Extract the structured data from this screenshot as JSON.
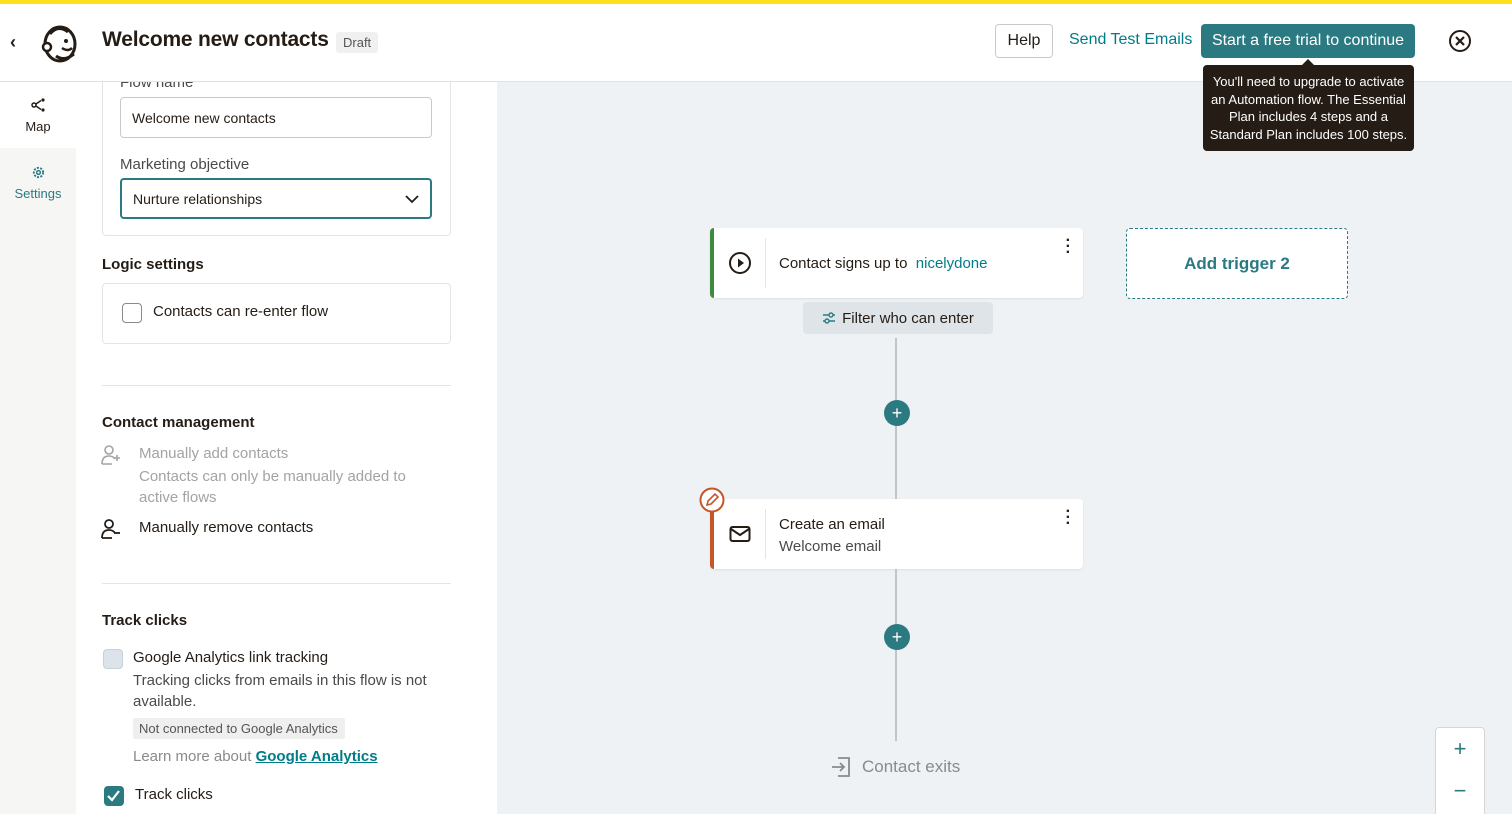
{
  "header": {
    "title": "Welcome new contacts",
    "badge": "Draft",
    "help_label": "Help",
    "send_test_label": "Send Test Emails",
    "trial_label": "Start a free trial to continue"
  },
  "tooltip": {
    "text": "You'll need to upgrade to activate an Automation flow. The Essential Plan includes 4 steps and a Standard Plan includes 100 steps."
  },
  "rail": {
    "map_label": "Map",
    "settings_label": "Settings"
  },
  "panel": {
    "flow_name_label": "Flow name",
    "flow_name_value": "Welcome new contacts",
    "objective_label": "Marketing objective",
    "objective_value": "Nurture relationships",
    "logic_heading": "Logic settings",
    "reenter_label": "Contacts can re-enter flow",
    "contact_mgmt_heading": "Contact management",
    "manual_add_title": "Manually add contacts",
    "manual_add_desc": "Contacts can only be manually added to active flows",
    "manual_remove_title": "Manually remove contacts",
    "track_heading": "Track clicks",
    "ga_title": "Google Analytics link tracking",
    "ga_desc": "Tracking clicks from emails in this flow is not available.",
    "ga_pill": "Not connected to Google Analytics",
    "learn_prefix": "Learn more about",
    "learn_link": "Google Analytics",
    "track_clicks_label": "Track clicks"
  },
  "canvas": {
    "trigger_text": "Contact signs up to",
    "trigger_audience": "nicelydone",
    "filter_label": "Filter who can enter",
    "add_trigger_label": "Add trigger 2",
    "email_title": "Create an email",
    "email_subtitle": "Welcome email",
    "exit_label": "Contact exits",
    "plus_symbol": "+",
    "zoom_in": "+",
    "zoom_out": "−"
  },
  "colors": {
    "accent": "#2b7a82",
    "brand_yellow": "#ffe01b",
    "trigger_bar": "#3e8a3e",
    "email_bar": "#c4572a"
  },
  "icons": [
    "back-chevron-icon",
    "mailchimp-logo-icon",
    "close-circle-icon",
    "map-share-icon",
    "gear-icon",
    "chevron-down-icon",
    "add-user-icon",
    "remove-user-icon",
    "check-icon",
    "play-circle-icon",
    "filter-sliders-icon",
    "envelope-icon",
    "pencil-icon",
    "exit-icon",
    "kebab-icon"
  ]
}
